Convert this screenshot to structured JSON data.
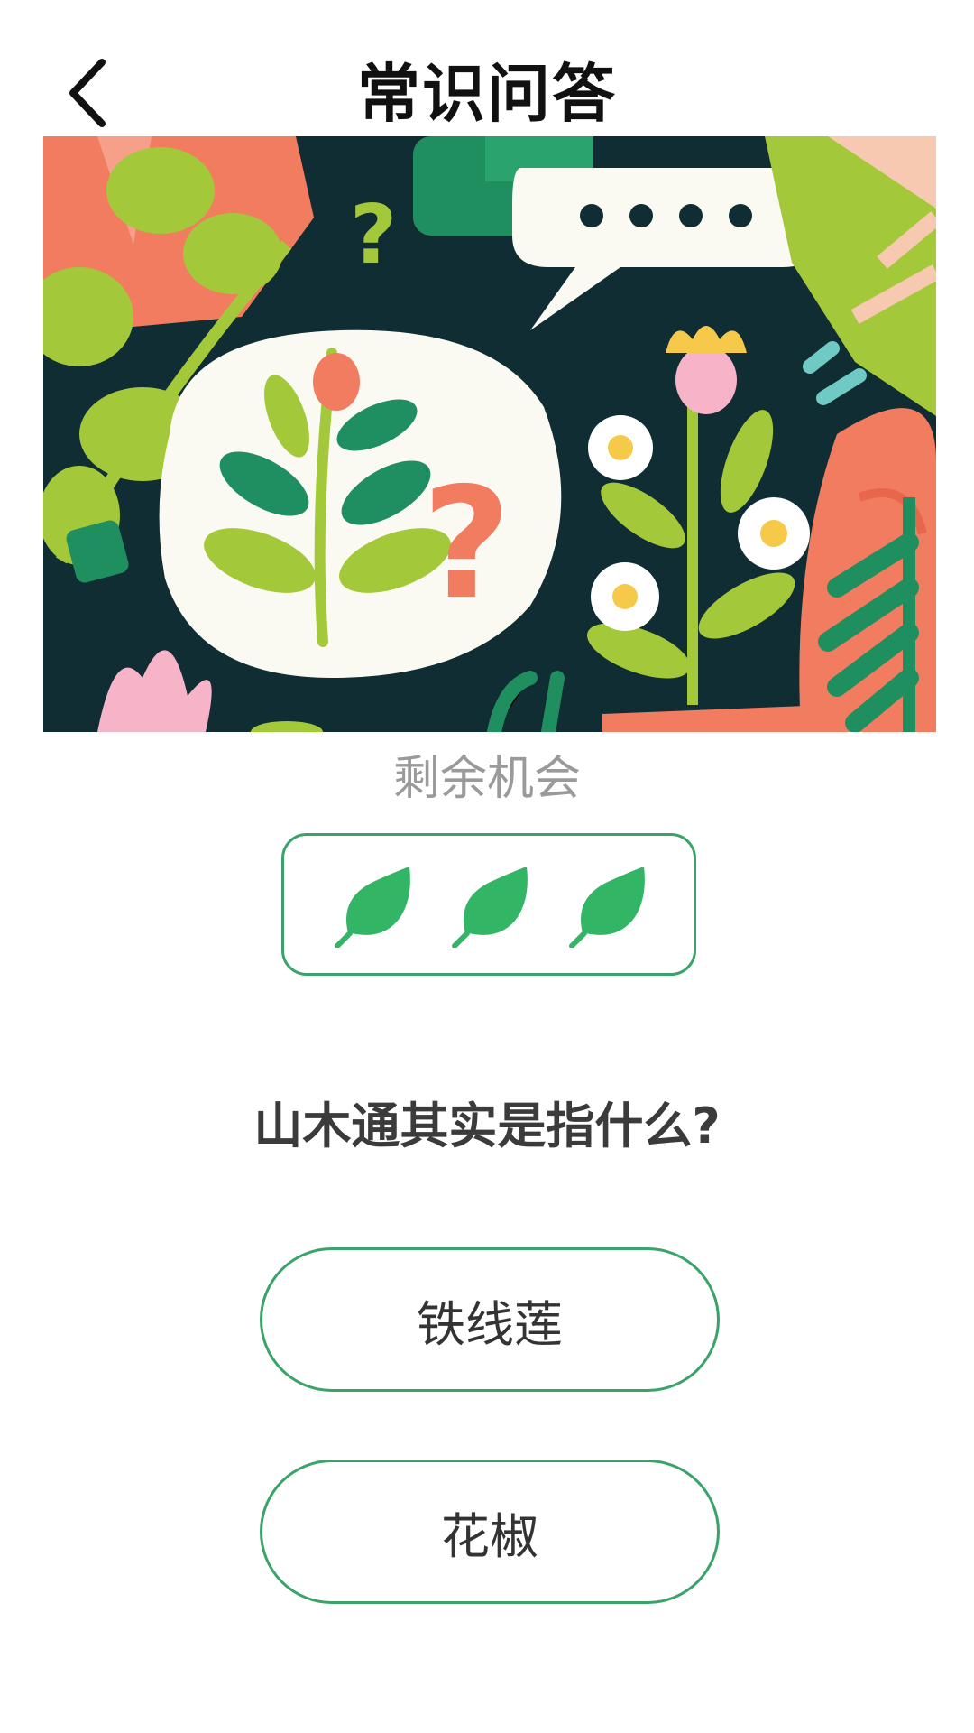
{
  "header": {
    "title": "常识问答",
    "back_icon": "chevron-left-icon"
  },
  "banner": {
    "illustration": "plant-quiz-illustration"
  },
  "chances": {
    "label": "剩余机会",
    "remaining": 3,
    "icon": "leaf-icon",
    "accent_color": "#33b566"
  },
  "question": {
    "text": "山木通其实是指什么?"
  },
  "options": [
    {
      "label": "铁线莲"
    },
    {
      "label": "花椒"
    }
  ],
  "colors": {
    "accent": "#3aa36a",
    "leaf": "#33b566",
    "banner_bg": "#0f2d33"
  }
}
